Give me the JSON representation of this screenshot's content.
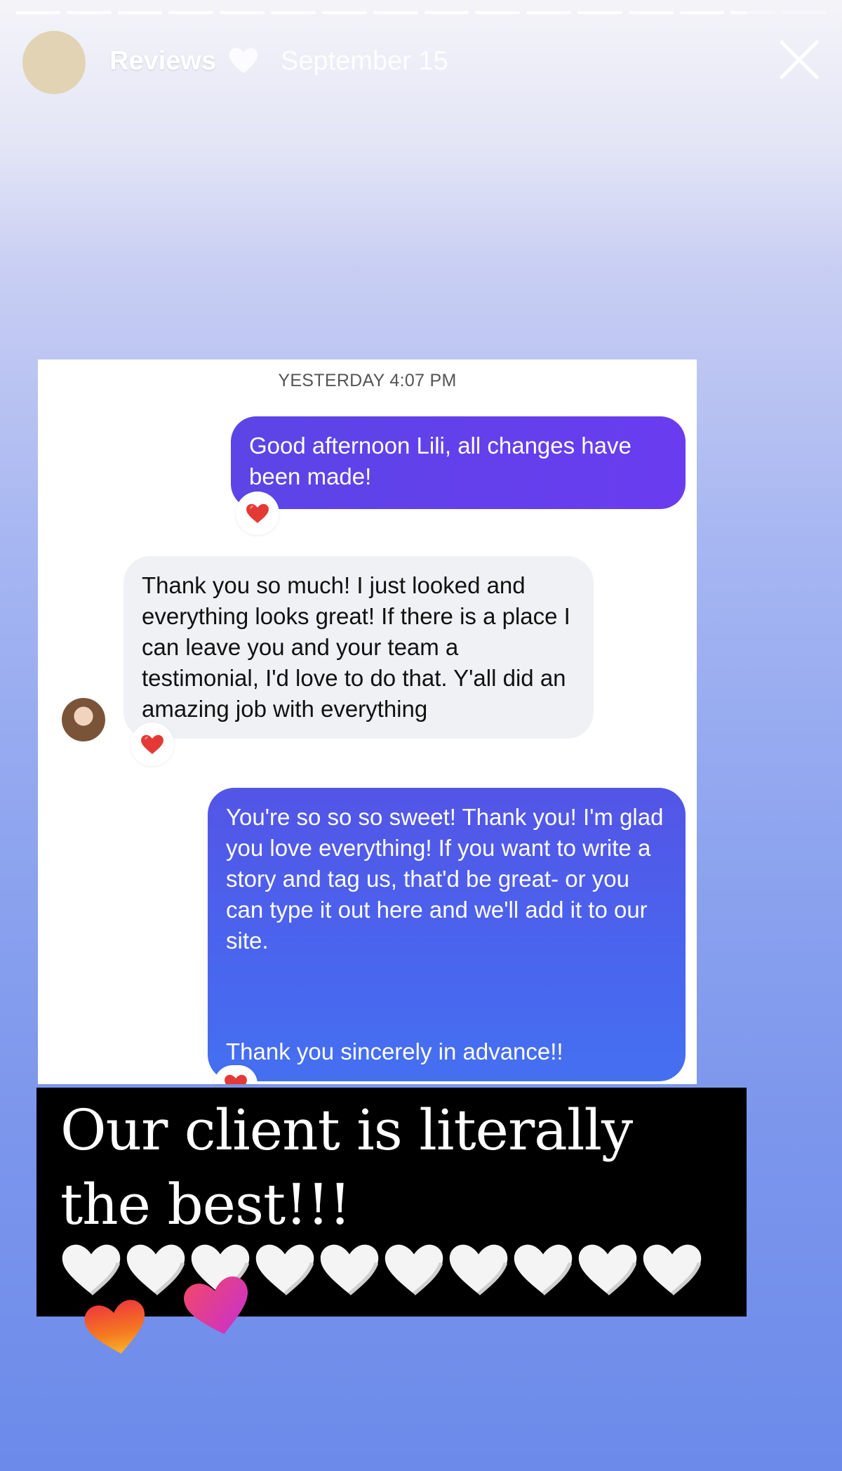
{
  "story": {
    "progress_segments": 16,
    "segments_complete": 14,
    "current_segment_fraction": 0.35,
    "title": "Reviews",
    "title_emoji": "white-heart-icon",
    "date": "September 15"
  },
  "chat": {
    "timestamp": "YESTERDAY 4:07 PM",
    "messages": [
      {
        "sender": "business",
        "text": "Good afternoon Lili, all changes have been made!",
        "reaction": "red-heart-icon"
      },
      {
        "sender": "client",
        "text": "Thank you so much! I just looked and everything looks great! If there is a place I can leave you and your team a testimonial, I'd love to do that. Y'all did an amazing job with everything",
        "reaction": "red-heart-icon"
      },
      {
        "sender": "business",
        "text": "You're so so so sweet! Thank you! I'm glad you love everything! If you want to write a story and tag us, that'd be great- or you can type it out here and we'll add it to our site.",
        "text_2": "Thank you sincerely in advance!!",
        "reaction": "red-heart-icon"
      }
    ]
  },
  "caption": {
    "text": "Our client is literally the best!!!",
    "heart_count": 10,
    "heart_icon": "white-heart-icon"
  },
  "colors": {
    "sent_bubble": "#6a3cf0",
    "sent_bubble_2": "#4a64ee",
    "received_bubble": "#f0f1f4",
    "reaction_heart": "#e53935",
    "caption_bg": "#000000"
  }
}
